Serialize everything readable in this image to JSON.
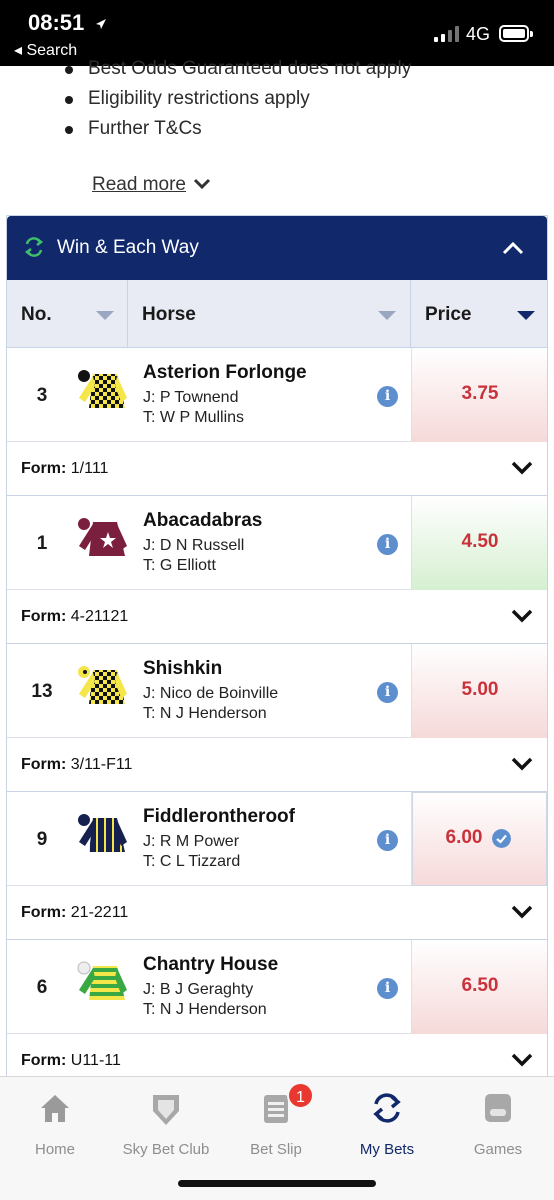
{
  "status_bar": {
    "time": "08:51",
    "back_label": "◂ Search",
    "network": "4G"
  },
  "terms": {
    "items": [
      "Best Odds Guaranteed does not apply",
      "Eligibility restrictions apply",
      "Further T&Cs"
    ],
    "read_more": "Read more"
  },
  "market": {
    "title": "Win & Each Way",
    "columns": {
      "no": "No.",
      "horse": "Horse",
      "price": "Price"
    },
    "form_label": "Form:",
    "runners": [
      {
        "no": "3",
        "name": "Asterion Forlonge",
        "jockey": "J: P Townend",
        "trainer": "T: W P Mullins",
        "price": "3.75",
        "form": "1/111",
        "silks": "yellow-black-check"
      },
      {
        "no": "1",
        "name": "Abacadabras",
        "jockey": "J: D N Russell",
        "trainer": "T: G Elliott",
        "price": "4.50",
        "form": "4-21121",
        "silks": "maroon-white-star"
      },
      {
        "no": "13",
        "name": "Shishkin",
        "jockey": "J: Nico de Boinville",
        "trainer": "T: N J Henderson",
        "price": "5.00",
        "form": "3/11-F11",
        "silks": "yellow-black-check"
      },
      {
        "no": "9",
        "name": "Fiddlerontheroof",
        "jockey": "J: R M Power",
        "trainer": "T: C L Tizzard",
        "price": "6.00",
        "form": "21-2211",
        "silks": "navy-yellow-stripes"
      },
      {
        "no": "6",
        "name": "Chantry House",
        "jockey": "J: B J Geraghty",
        "trainer": "T: N J Henderson",
        "price": "6.50",
        "form": "U11-11",
        "silks": "green-yellow-hoops"
      }
    ]
  },
  "tabbar": {
    "tabs": [
      {
        "label": "Home",
        "icon": "home-icon"
      },
      {
        "label": "Sky Bet Club",
        "icon": "club-icon"
      },
      {
        "label": "Bet Slip",
        "icon": "betslip-icon"
      },
      {
        "label": "My Bets",
        "icon": "mybets-icon"
      },
      {
        "label": "Games",
        "icon": "games-icon"
      }
    ],
    "betslip_badge": "1",
    "active_color": "#11296b"
  },
  "colors": {
    "header_bg": "#11296b",
    "price_text": "#c8323b",
    "price_drift_bg": "#f6d9d9",
    "price_shortened_bg": "#d6efd1"
  }
}
